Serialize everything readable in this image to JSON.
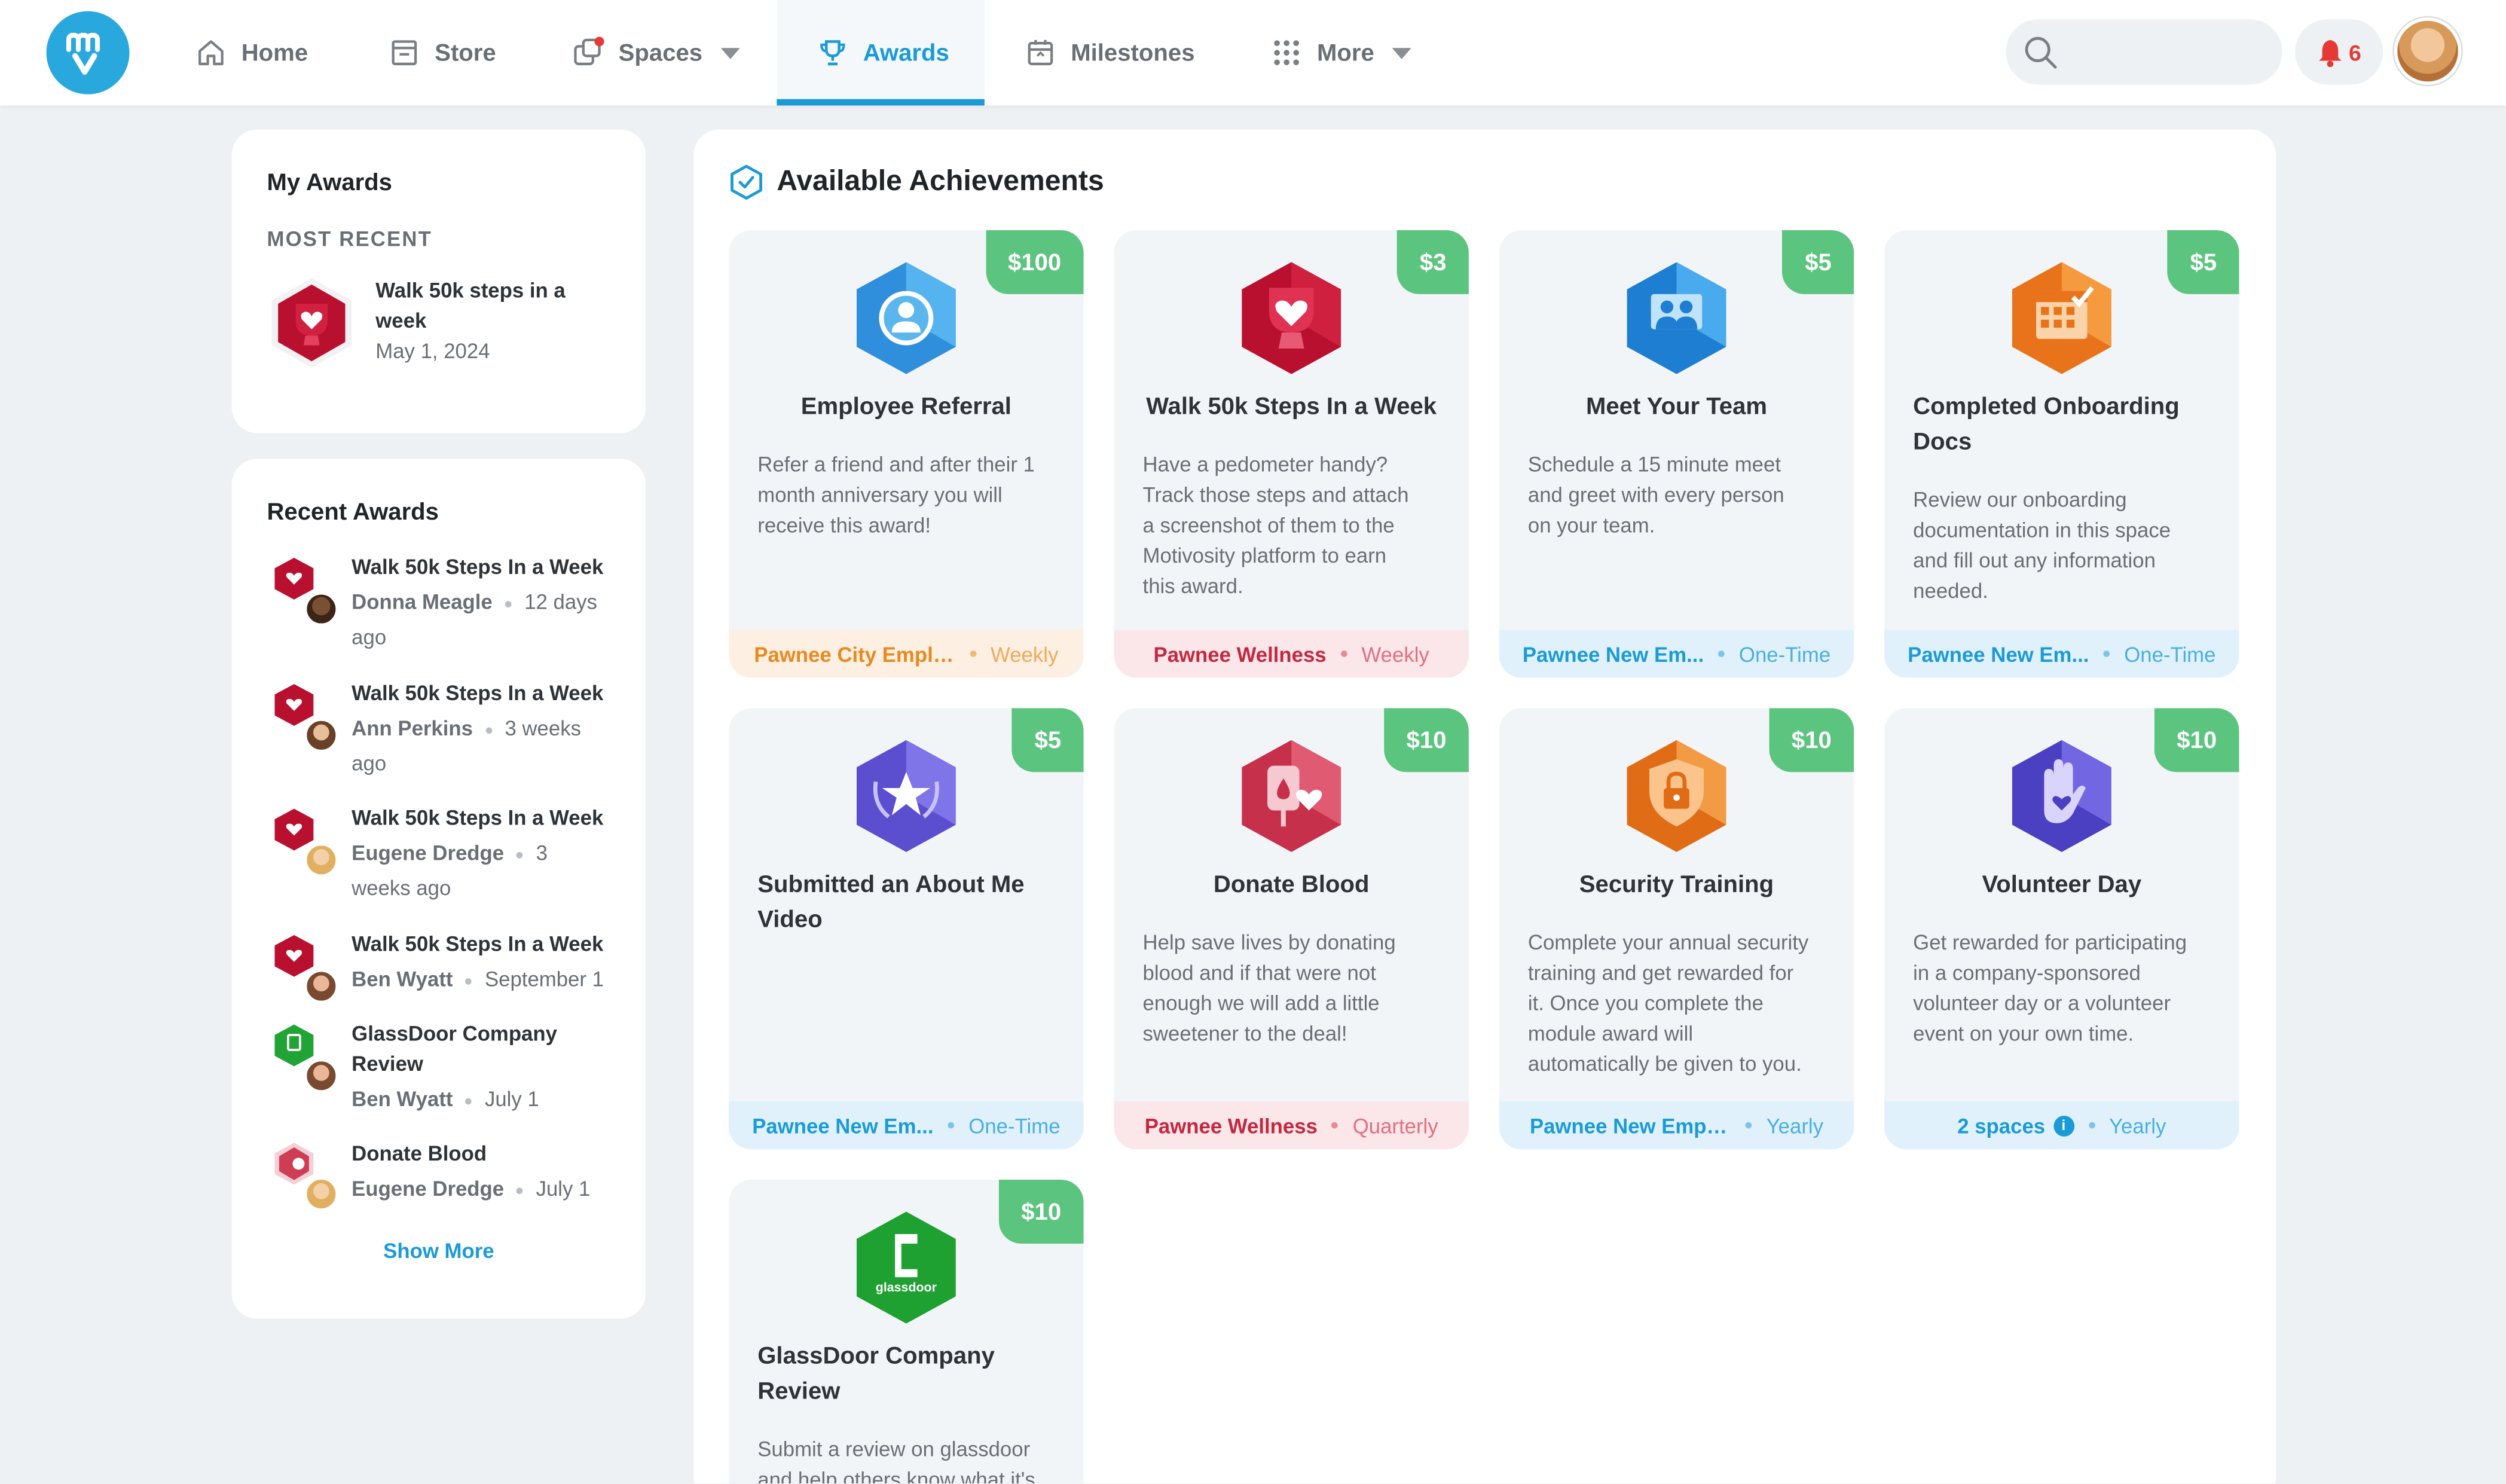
{
  "nav": {
    "home": "Home",
    "store": "Store",
    "spaces": "Spaces",
    "awards": "Awards",
    "milestones": "Milestones",
    "more": "More",
    "notification_count": "6"
  },
  "my_awards": {
    "title": "My Awards",
    "section": "MOST RECENT",
    "recent": {
      "line1": "Walk 50k steps in a",
      "line2": "week",
      "date": "May 1, 2024"
    }
  },
  "recent_awards": {
    "title": "Recent Awards",
    "items": [
      {
        "title": "Walk 50k Steps In a Week",
        "who": "Donna Meagle",
        "when_a": "12 days",
        "when_b": "ago"
      },
      {
        "title": "Walk 50k Steps In a Week",
        "who": "Ann Perkins",
        "when_a": "3 weeks",
        "when_b": "ago"
      },
      {
        "title": "Walk 50k Steps In a Week",
        "who": "Eugene Dredge",
        "when_a": "3",
        "when_b": "weeks ago"
      },
      {
        "title": "Walk 50k Steps In a Week",
        "who": "Ben Wyatt",
        "when_a": "September 1",
        "when_b": ""
      },
      {
        "title_a": "GlassDoor Company",
        "title_b": "Review",
        "who": "Ben Wyatt",
        "when_a": "July 1",
        "when_b": ""
      },
      {
        "title": "Donate Blood",
        "who": "Eugene Dredge",
        "when_a": "July 1",
        "when_b": ""
      }
    ],
    "show_more": "Show More"
  },
  "achievements": {
    "title": "Available Achievements",
    "cards": [
      {
        "price": "$100",
        "title": "Employee Referral",
        "desc": [
          "Refer a friend and after their 1",
          "month anniversary you will",
          "receive this award!"
        ],
        "space": "Pawnee City Emplo...",
        "freq": "Weekly",
        "icon": "referral-icon"
      },
      {
        "price": "$3",
        "title": "Walk 50k Steps In a Week",
        "desc": [
          "Have a pedometer handy?",
          "Track those steps and attach",
          "a screenshot of them to the",
          "Motivosity platform to earn",
          "this award."
        ],
        "space": "Pawnee Wellness",
        "freq": "Weekly",
        "icon": "heart-trophy-icon"
      },
      {
        "price": "$5",
        "title": "Meet Your Team",
        "desc": [
          "Schedule a 15 minute meet",
          "and greet with every person",
          "on your team."
        ],
        "space": "Pawnee New Em...",
        "freq": "One-Time",
        "icon": "team-icon"
      },
      {
        "price": "$5",
        "title_a": "Completed Onboarding",
        "title_b": "Docs",
        "desc": [
          "Review our onboarding",
          "documentation in this space",
          "and fill out any information",
          "needed."
        ],
        "space": "Pawnee New Em...",
        "freq": "One-Time",
        "icon": "calendar-icon"
      },
      {
        "price": "$5",
        "title_a": "Submitted an About Me",
        "title_b": "Video",
        "desc": [],
        "space": "Pawnee New Em...",
        "freq": "One-Time",
        "icon": "star-wreath-icon"
      },
      {
        "price": "$10",
        "title": "Donate Blood",
        "desc": [
          "Help save lives by donating",
          "blood and if that were not",
          "enough we will add a little",
          "sweetener to the deal!"
        ],
        "space": "Pawnee Wellness",
        "freq": "Quarterly",
        "icon": "blood-bag-icon"
      },
      {
        "price": "$10",
        "title": "Security Training",
        "desc": [
          "Complete your annual security",
          "training and get rewarded for",
          "it. Once you complete the",
          "module award will",
          "automatically be given to you."
        ],
        "space": "Pawnee New Emplo...",
        "freq": "Yearly",
        "icon": "shield-lock-icon"
      },
      {
        "price": "$10",
        "title": "Volunteer Day",
        "desc": [
          "Get rewarded for participating",
          "in a company-sponsored",
          "volunteer day or a volunteer",
          "event on your own time."
        ],
        "space": "2 spaces",
        "freq": "Yearly",
        "icon": "hand-heart-icon"
      },
      {
        "price": "$10",
        "title_a": "GlassDoor Company",
        "title_b": "Review",
        "desc": [
          "Submit a review on glassdoor",
          "and help others know what it's"
        ],
        "icon_text": "glassdoor",
        "icon": "glassdoor-icon"
      }
    ]
  },
  "colors": {
    "accent": "#1a9bd7",
    "price": "#5bc47e",
    "alert": "#e53935"
  }
}
